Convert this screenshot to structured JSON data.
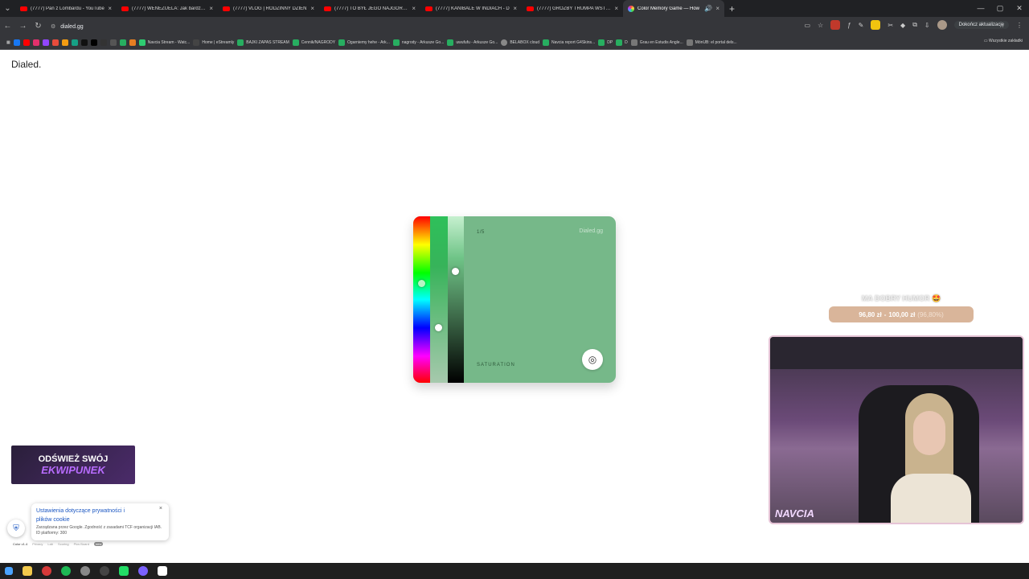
{
  "browser": {
    "tabs": [
      {
        "title": "(7777) Pan z Lombardu - YouTube",
        "active": false
      },
      {
        "title": "(7777) WENEZUELA: Jak bardzo jest",
        "active": false
      },
      {
        "title": "(7777) VLOG | RODZINNY DZIEŃ",
        "active": false
      },
      {
        "title": "(7777) TO BYŁ JEGO NAJGORSZY",
        "active": false
      },
      {
        "title": "(7777) KANIBALE W INDIACH - D",
        "active": false
      },
      {
        "title": "(7777) GROŹBY TRUMPA WSTRZĄ",
        "active": false
      },
      {
        "title": "Color Memory Game — How",
        "active": true
      }
    ],
    "url": "dialed.gg",
    "update_label": "Dokończ aktualizację",
    "bookmarks": [
      {
        "label": "Navcia Stream - Watc...",
        "color": "#2ecc71"
      },
      {
        "label": "Home | eStreamly",
        "color": "#444"
      },
      {
        "label": "BAJKI ZAPAS STREAM",
        "color": "#27ae60"
      },
      {
        "label": "Cennik/NAGRODY",
        "color": "#27ae60"
      },
      {
        "label": "Ogarniemy hehe - Ark...",
        "color": "#27ae60"
      },
      {
        "label": "nagrody - Arkusze Go...",
        "color": "#27ae60"
      },
      {
        "label": "uwufufu - Arkusze Go...",
        "color": "#27ae60"
      },
      {
        "label": "BELABOX cloud",
        "color": "#888"
      },
      {
        "label": "Navcia report G4Skins...",
        "color": "#27ae60"
      },
      {
        "label": "DP",
        "color": "#27ae60"
      },
      {
        "label": "D",
        "color": "#27ae60"
      },
      {
        "label": "Grau en Estudis Angle...",
        "color": "#777"
      },
      {
        "label": "MónUB: el portal dels...",
        "color": "#777"
      }
    ],
    "all_bookmarks_label": "Wszystkie zakładki"
  },
  "page": {
    "logo": "Dialed.",
    "game": {
      "counter": "1/5",
      "brand": "Dialed.gg",
      "slider_label": "SATURATION",
      "current_color": "#76b889"
    },
    "promo": {
      "line1": "ODŚWIEŻ SWÓJ",
      "line2": "EKWIPUNEK"
    },
    "cookie": {
      "title": "Ustawienia dotyczące prywatności i plików cookie",
      "subtitle": "Zarządzana przez Google. Zgodność z zasadami TCF organizacji IAB. ID platformy: 300",
      "close": "×"
    },
    "footer": {
      "version": "Color v1.4",
      "links": [
        "Privacy",
        "Lab",
        "Scoring",
        "Pics Board"
      ],
      "badge": "new"
    }
  },
  "stream_overlay": {
    "donation_message": "MA DOBRY HUMOR 🤩",
    "donation_current": "96,80 zł",
    "donation_goal": "100,00 zł",
    "donation_percent": "(96,80%)",
    "streamer_name": "NAVCIA"
  }
}
